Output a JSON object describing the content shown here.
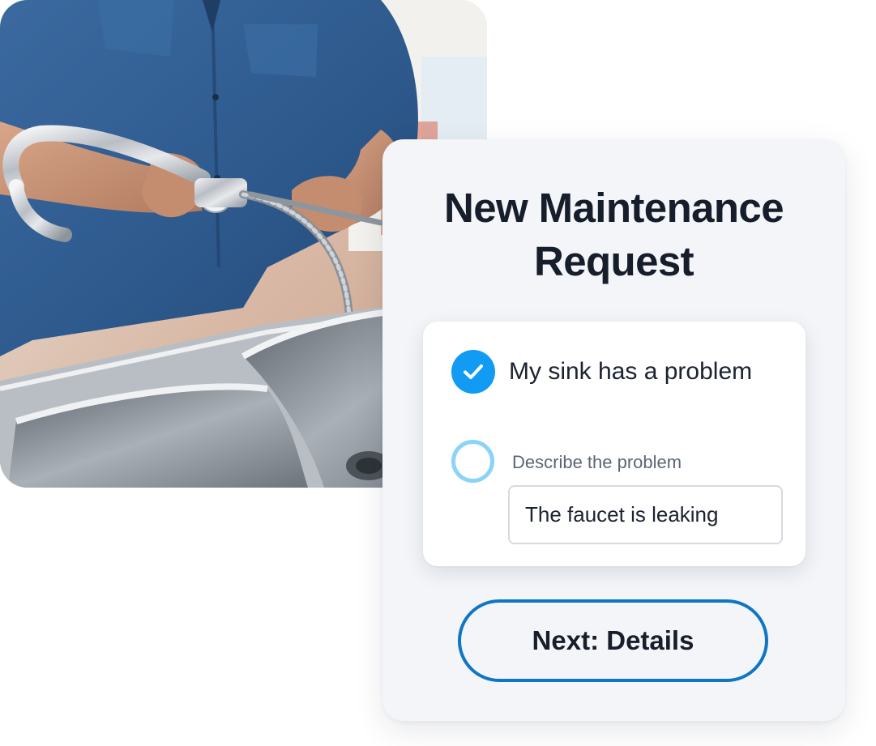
{
  "photo": {
    "description_icon": "plumber-photo"
  },
  "card": {
    "title_line1": "New Maintenance",
    "title_line2": "Request"
  },
  "form": {
    "option_checked": true,
    "option_label": "My sink has a problem",
    "field_label": "Describe the problem",
    "field_value": "The faucet is leaking"
  },
  "actions": {
    "next_label": "Next: Details"
  },
  "colors": {
    "accent": "#119bf2",
    "accent_light": "#8ad3fb",
    "button_border": "#0f75c5",
    "title": "#161d2b",
    "card_bg": "#f3f5f8"
  }
}
